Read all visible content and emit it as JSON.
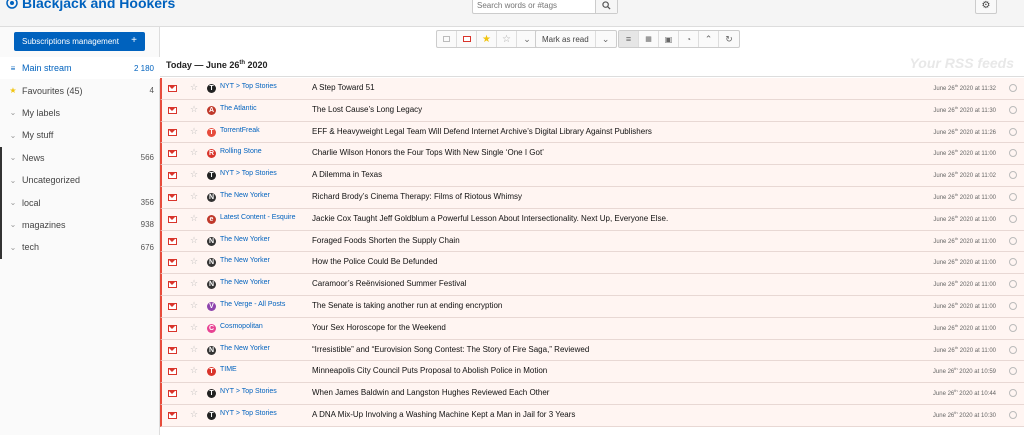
{
  "app": {
    "title": "Blackjack and Hookers"
  },
  "search": {
    "placeholder": "Search words or #tags"
  },
  "toolbar": {
    "mark_as_read": "Mark as read"
  },
  "sidebar": {
    "subscriptions_button": "Subscriptions management",
    "items": [
      {
        "label": "Main stream",
        "count": "2 180",
        "icon": "list-icon"
      },
      {
        "label": "Favourites (45)",
        "count": "4",
        "icon": "star-icon"
      },
      {
        "label": "My labels",
        "count": "",
        "icon": "chevron-icon"
      },
      {
        "label": "My stuff",
        "count": "",
        "icon": "chevron-icon"
      },
      {
        "label": "News",
        "count": "566",
        "icon": "chevron-icon"
      },
      {
        "label": "Uncategorized",
        "count": "",
        "icon": "chevron-icon"
      },
      {
        "label": "local",
        "count": "356",
        "icon": "chevron-icon"
      },
      {
        "label": "magazines",
        "count": "938",
        "icon": "chevron-icon"
      },
      {
        "label": "tech",
        "count": "676",
        "icon": "chevron-icon"
      }
    ]
  },
  "stream": {
    "day_prefix": "Today — June 26",
    "day_sup": "th",
    "day_suffix": " 2020",
    "watermark": "Your RSS feeds"
  },
  "articles": [
    {
      "feed": "NYT > Top Stories",
      "title": "A Step Toward 51",
      "date_pre": "June 26",
      "date_post": " 2020 at 11:32",
      "icon_color": "#222",
      "icon_char": "T"
    },
    {
      "feed": "The Atlantic",
      "title": "The Lost Cause’s Long Legacy",
      "date_pre": "June 26",
      "date_post": " 2020 at 11:30",
      "icon_color": "#c0392b",
      "icon_char": "A"
    },
    {
      "feed": "TorrentFreak",
      "title": "EFF & Heavyweight Legal Team Will Defend Internet Archive’s Digital Library Against Publishers",
      "date_pre": "June 26",
      "date_post": " 2020 at 11:26",
      "icon_color": "#e74c3c",
      "icon_char": "T"
    },
    {
      "feed": "Rolling Stone",
      "title": "Charlie Wilson Honors the Four Tops With New Single ‘One I Got’",
      "date_pre": "June 26",
      "date_post": " 2020 at 11:00",
      "icon_color": "#d9342b",
      "icon_char": "R"
    },
    {
      "feed": "NYT > Top Stories",
      "title": "A Dilemma in Texas",
      "date_pre": "June 26",
      "date_post": " 2020 at 11:02",
      "icon_color": "#222",
      "icon_char": "T"
    },
    {
      "feed": "The New Yorker",
      "title": "Richard Brody’s Cinema Therapy: Films of Riotous Whimsy",
      "date_pre": "June 26",
      "date_post": " 2020 at 11:00",
      "icon_color": "#333",
      "icon_char": "N"
    },
    {
      "feed": "Latest Content - Esquire",
      "title": "Jackie Cox Taught Jeff Goldblum a Powerful Lesson About Intersectionality. Next Up, Everyone Else.",
      "date_pre": "June 26",
      "date_post": " 2020 at 11:00",
      "icon_color": "#c0392b",
      "icon_char": "e"
    },
    {
      "feed": "The New Yorker",
      "title": "Foraged Foods Shorten the Supply Chain",
      "date_pre": "June 26",
      "date_post": " 2020 at 11:00",
      "icon_color": "#333",
      "icon_char": "N"
    },
    {
      "feed": "The New Yorker",
      "title": "How the Police Could Be Defunded",
      "date_pre": "June 26",
      "date_post": " 2020 at 11:00",
      "icon_color": "#333",
      "icon_char": "N"
    },
    {
      "feed": "The New Yorker",
      "title": "Caramoor’s Reënvisioned Summer Festival",
      "date_pre": "June 26",
      "date_post": " 2020 at 11:00",
      "icon_color": "#333",
      "icon_char": "N"
    },
    {
      "feed": "The Verge - All Posts",
      "title": "The Senate is taking another run at ending encryption",
      "date_pre": "June 26",
      "date_post": " 2020 at 11:00",
      "icon_color": "#8e44ad",
      "icon_char": "V"
    },
    {
      "feed": "Cosmopolitan",
      "title": "Your Sex Horoscope for the Weekend",
      "date_pre": "June 26",
      "date_post": " 2020 at 11:00",
      "icon_color": "#e84393",
      "icon_char": "C"
    },
    {
      "feed": "The New Yorker",
      "title": "“Irresistible” and “Eurovision Song Contest: The Story of Fire Saga,” Reviewed",
      "date_pre": "June 26",
      "date_post": " 2020 at 11:00",
      "icon_color": "#333",
      "icon_char": "N"
    },
    {
      "feed": "TIME",
      "title": "Minneapolis City Council Puts Proposal to Abolish Police in Motion",
      "date_pre": "June 26",
      "date_post": " 2020 at 10:59",
      "icon_color": "#d9342b",
      "icon_char": "T"
    },
    {
      "feed": "NYT > Top Stories",
      "title": "When James Baldwin and Langston Hughes Reviewed Each Other",
      "date_pre": "June 26",
      "date_post": " 2020 at 10:44",
      "icon_color": "#222",
      "icon_char": "T"
    },
    {
      "feed": "NYT > Top Stories",
      "title": "A DNA Mix-Up Involving a Washing Machine Kept a Man in Jail for 3 Years",
      "date_pre": "June 26",
      "date_post": " 2020 at 10:30",
      "icon_color": "#222",
      "icon_char": "T"
    }
  ],
  "date_sup": "th"
}
